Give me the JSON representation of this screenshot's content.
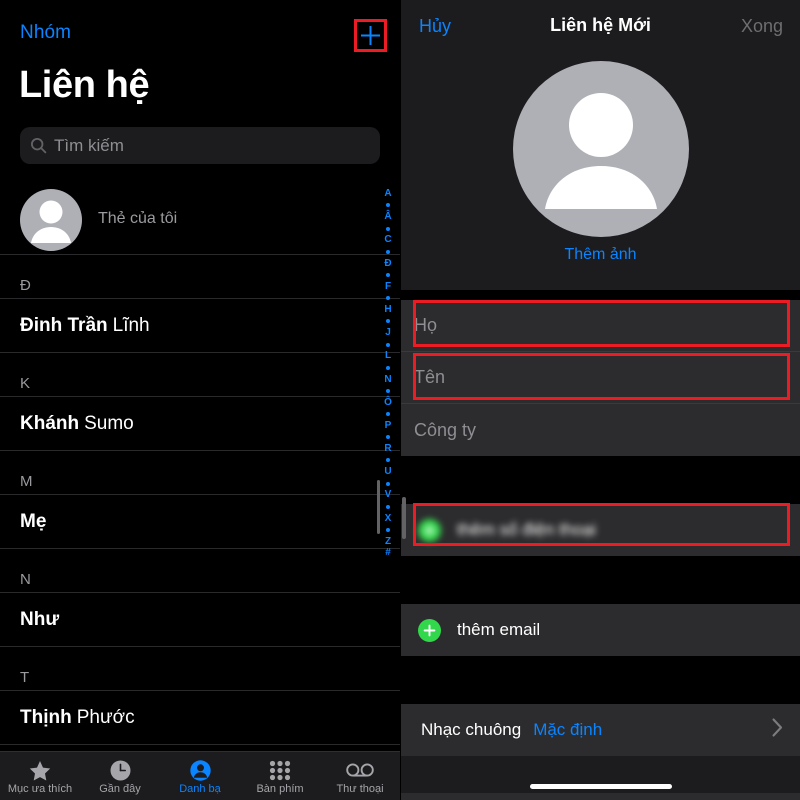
{
  "colors": {
    "accent_blue": "#0a84ff",
    "highlight_red": "#ec1c24",
    "green": "#32d74b",
    "panel_bg": "#1c1c1e",
    "row_bg": "#2c2c2e",
    "list_bg": "#000000"
  },
  "contacts_screen": {
    "nav": {
      "groups_label": "Nhóm",
      "add_icon": "plus-icon"
    },
    "title": "Liên hệ",
    "search": {
      "placeholder": "Tìm kiếm",
      "icon": "search-icon"
    },
    "my_card": {
      "label": "Thẻ của tôi",
      "avatar_icon": "person-avatar-icon"
    },
    "sections": [
      {
        "letter": "Đ",
        "contacts": [
          {
            "first": "Đinh Trần",
            "last": "Lĩnh"
          }
        ]
      },
      {
        "letter": "K",
        "contacts": [
          {
            "first": "Khánh",
            "last": "Sumo"
          }
        ]
      },
      {
        "letter": "M",
        "contacts": [
          {
            "first": "Mẹ",
            "last": ""
          }
        ]
      },
      {
        "letter": "N",
        "contacts": [
          {
            "first": "Như",
            "last": ""
          }
        ]
      },
      {
        "letter": "T",
        "contacts": [
          {
            "first": "Thịnh",
            "last": "Phước"
          }
        ]
      }
    ],
    "index_strip": [
      "A",
      "Â",
      "C",
      "Đ",
      "F",
      "H",
      "J",
      "L",
      "N",
      "Ô",
      "P",
      "R",
      "U",
      "V",
      "X",
      "Z",
      "#"
    ],
    "tabs": [
      {
        "label": "Mục ưa thích",
        "icon": "star-icon",
        "active": false
      },
      {
        "label": "Gần đây",
        "icon": "clock-icon",
        "active": false
      },
      {
        "label": "Danh bạ",
        "icon": "person-circle-icon",
        "active": true
      },
      {
        "label": "Bàn phím",
        "icon": "keypad-icon",
        "active": false
      },
      {
        "label": "Thư thoại",
        "icon": "voicemail-icon",
        "active": false
      }
    ]
  },
  "new_contact_screen": {
    "nav": {
      "cancel_label": "Hủy",
      "title": "Liên hệ Mới",
      "done_label": "Xong"
    },
    "avatar": {
      "icon": "person-avatar-icon",
      "add_photo_label": "Thêm ảnh"
    },
    "name_fields": [
      {
        "placeholder": "Họ",
        "value": "",
        "highlighted": true
      },
      {
        "placeholder": "Tên",
        "value": "",
        "highlighted": true
      },
      {
        "placeholder": "Công ty",
        "value": "",
        "highlighted": false
      }
    ],
    "add_phone": {
      "label": "thêm số điện thoại",
      "icon": "green-plus-icon",
      "highlighted": true,
      "blurred": true
    },
    "add_email": {
      "label": "thêm email",
      "icon": "green-plus-icon"
    },
    "ringtone": {
      "label": "Nhạc chuông",
      "value": "Mặc định",
      "chevron": "chevron-right-icon"
    }
  }
}
